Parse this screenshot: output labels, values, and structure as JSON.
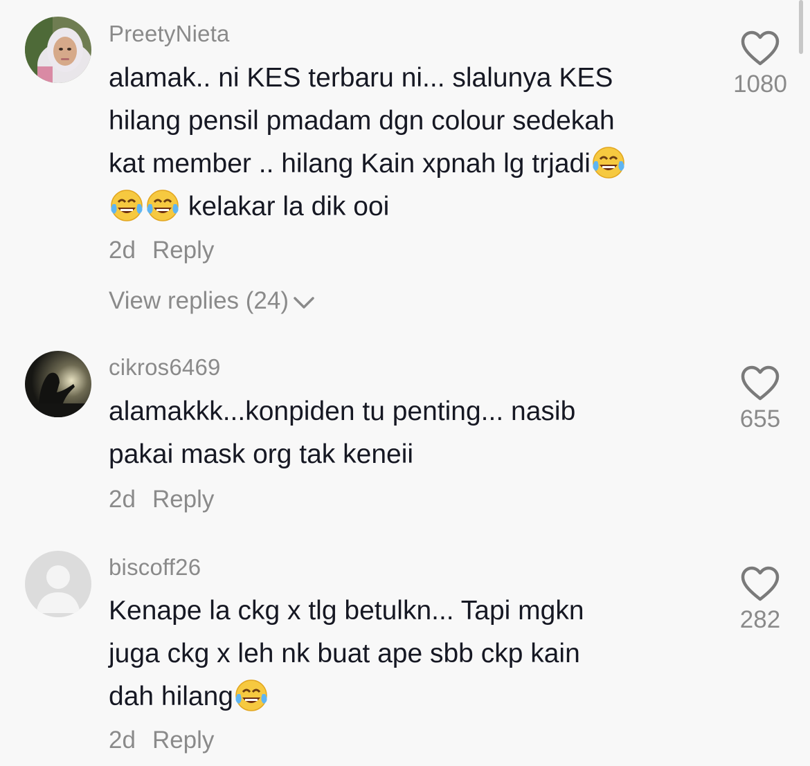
{
  "comments": [
    {
      "username": "PreetyNieta",
      "text_lines": [
        "alamak.. ni KES terbaru ni... slalunya KES",
        "hilang pensil pmadam dgn colour sedekah",
        "kat member .. hilang Kain xpnah lg trjadi",
        " kelakar la dik ooi"
      ],
      "time": "2d",
      "reply_label": "Reply",
      "view_replies": "View replies (24)",
      "likes": "1080"
    },
    {
      "username": "cikros6469",
      "text_lines": [
        "alamakkk...konpiden tu penting... nasib",
        "pakai mask org tak keneii"
      ],
      "time": "2d",
      "reply_label": "Reply",
      "likes": "655"
    },
    {
      "username": "biscoff26",
      "text_lines": [
        "Kenape la ckg x tlg betulkn... Tapi mgkn",
        "juga ckg x leh nk buat ape sbb ckp kain",
        "dah hilang"
      ],
      "time": "2d",
      "reply_label": "Reply",
      "likes": "282"
    }
  ],
  "icons": {
    "like": "heart-outline-icon",
    "expand": "chevron-down-icon",
    "emoji": "face-with-tears-of-joy-emoji"
  }
}
